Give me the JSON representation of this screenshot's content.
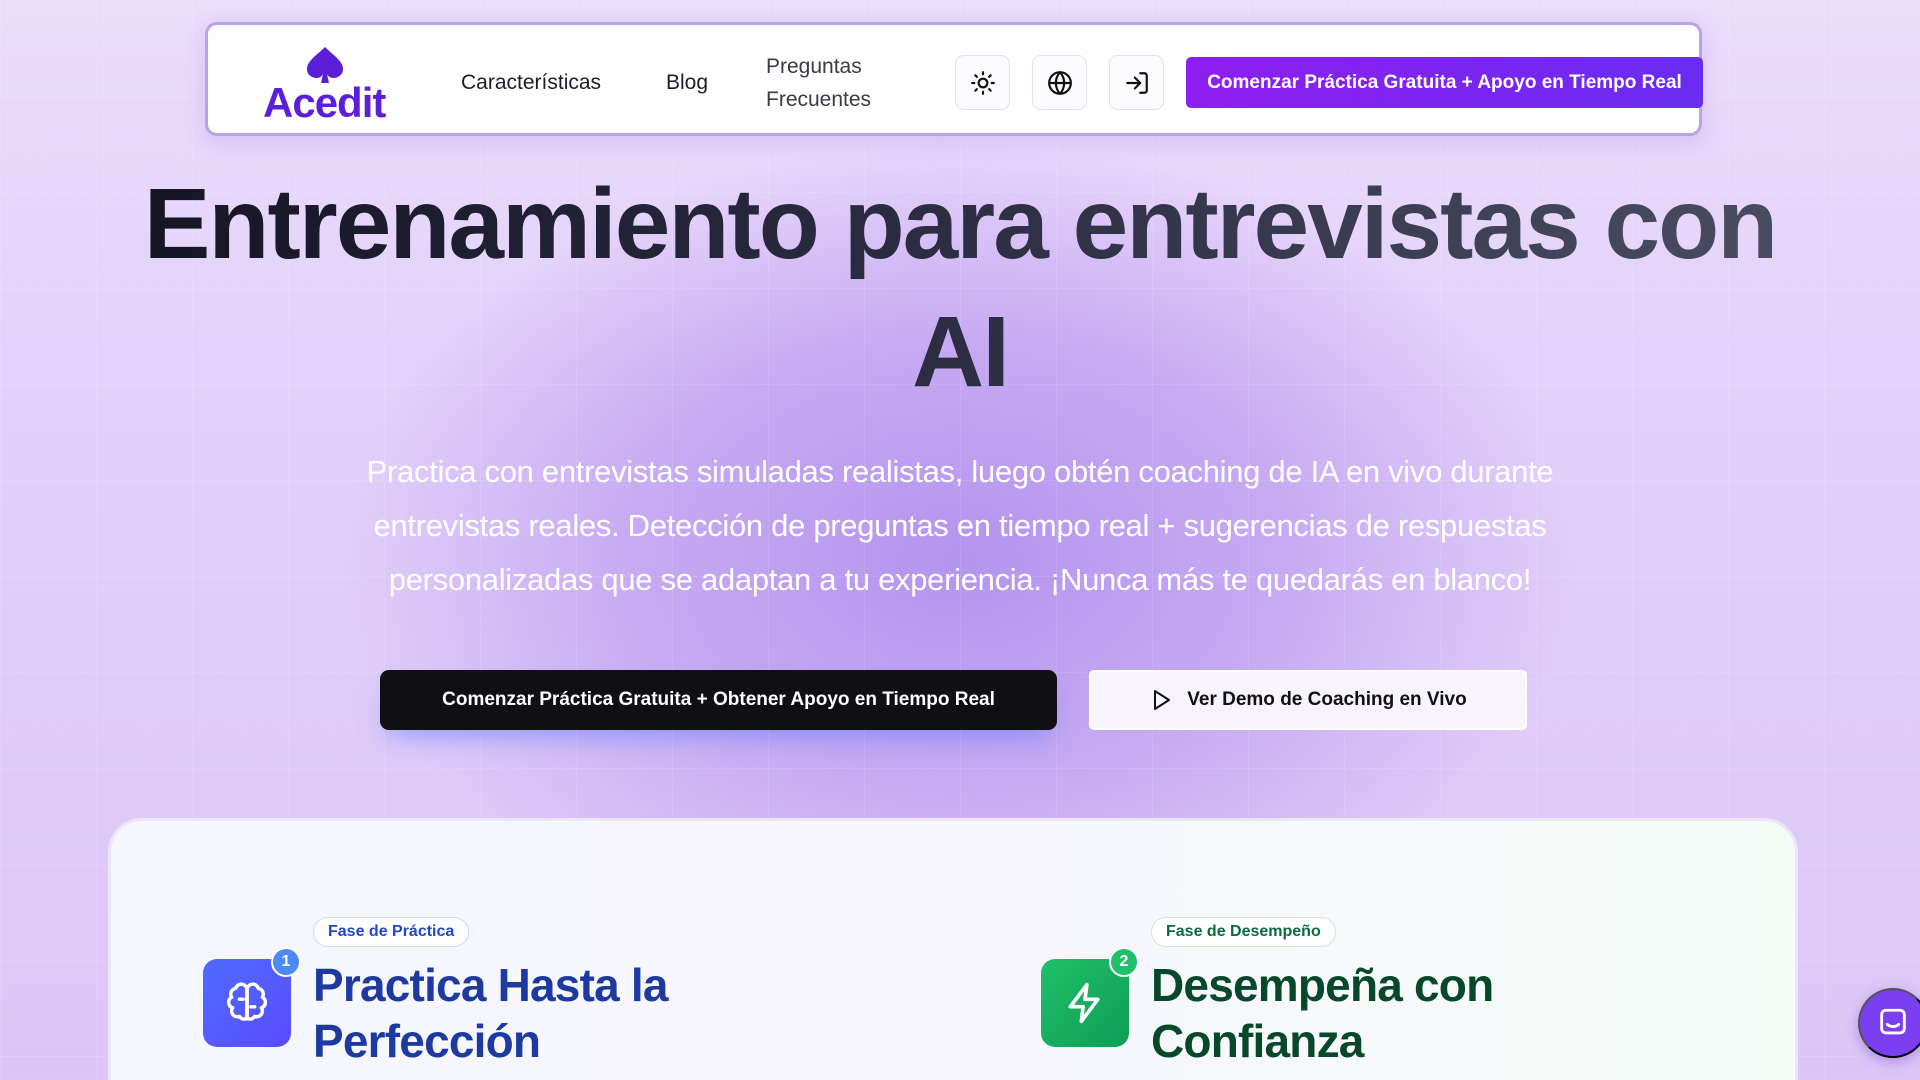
{
  "brand": {
    "name": "Acedit",
    "logo_color": "#5b1fd8"
  },
  "nav": {
    "features": "Características",
    "blog": "Blog",
    "faq_line1": "Preguntas",
    "faq_line2": "Frecuentes",
    "icons": [
      "sun-icon",
      "globe-icon",
      "login-icon"
    ],
    "cta": "Comenzar Práctica Gratuita + Apoyo en Tiempo Real"
  },
  "hero": {
    "title_line1": "Entrenamiento para entrevistas con",
    "title_line2": "AI",
    "subtitle": "Practica con entrevistas simuladas realistas, luego obtén coaching de IA en vivo durante entrevistas reales. Detección de preguntas en tiempo real + sugerencias de respuestas personalizadas que se adaptan a tu experiencia. ¡Nunca más te quedarás en blanco!",
    "cta_primary": "Comenzar Práctica Gratuita + Obtener Apoyo en Tiempo Real",
    "cta_secondary": "Ver Demo de Coaching en Vivo"
  },
  "phases": [
    {
      "number": "1",
      "badge": "Fase de Práctica",
      "title": "Practica Hasta la Perfección",
      "icon": "brain-icon",
      "color": "#4f6cff"
    },
    {
      "number": "2",
      "badge": "Fase de Desempeño",
      "title": "Desempeña con Confianza",
      "icon": "lightning-icon",
      "color": "#20c06a"
    }
  ],
  "colors": {
    "accent": "#7b2ff0",
    "primary_button": "#0f0f14",
    "background": "#e2cffa"
  }
}
